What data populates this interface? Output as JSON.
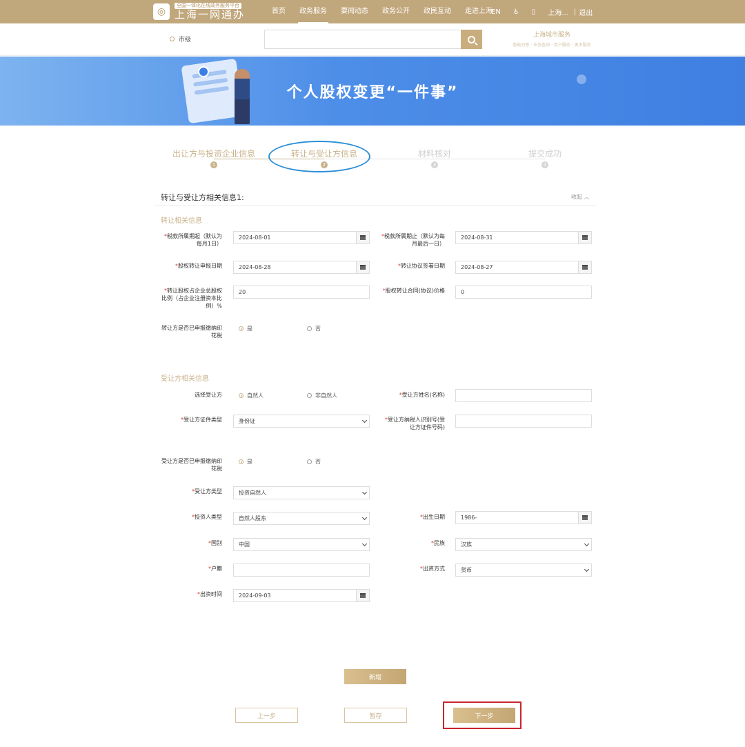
{
  "header": {
    "logo_subtitle": "全国一体化在线政务服务平台",
    "logo_title": "上海一网通办",
    "nav": [
      "首页",
      "政务服务",
      "要闻动态",
      "政务公开",
      "政民互动",
      "走进上海"
    ],
    "active_nav": 1,
    "lang": "EN",
    "user": "上海...",
    "divider": "|",
    "logout": "退出"
  },
  "search": {
    "region": "市级",
    "placeholder": "",
    "city_title": "上海城市服务",
    "city_links": "智能问答 · 业务查询 · 用户服务 · 更多服务"
  },
  "banner": {
    "title": "个人股权变更“一件事”"
  },
  "steps": [
    {
      "label": "出让方与投资企业信息",
      "num": "1"
    },
    {
      "label": "转让与受让方信息",
      "num": "2"
    },
    {
      "label": "材料核对",
      "num": "3"
    },
    {
      "label": "提交成功",
      "num": "4"
    }
  ],
  "form": {
    "section_title": "转让与受让方相关信息1:",
    "collapse": "收起",
    "transfer_subtitle": "转让相关信息",
    "tax_start_label": "税款所属期起（默认为每月1日）",
    "tax_start_value": "2024-08-01",
    "tax_end_label": "税款所属期止（默认为每月最后一日）",
    "tax_end_value": "2024-08-31",
    "declare_date_label": "股权转让申报日期",
    "declare_date_value": "2024-08-28",
    "sign_date_label": "转让协议签署日期",
    "sign_date_value": "2024-08-27",
    "ratio_label": "转让股权占企业总股权比例（占企业注册资本比例）%",
    "ratio_value": "20",
    "price_label": "股权转让合同(协议)价格",
    "price_value": "0",
    "stamp_tax_label": "转让方是否已申报缴纳印花税",
    "yes": "是",
    "no": "否",
    "receiver_subtitle": "受让方相关信息",
    "select_receiver_label": "选择受让方",
    "natural_person": "自然人",
    "non_natural_person": "非自然人",
    "receiver_name_label": "受让方姓名(名称)",
    "receiver_name_value": "",
    "cert_type_label": "受让方证件类型",
    "cert_type_value": "身份证",
    "tax_id_label": "受让方纳税人识别号(受让方证件号码)",
    "tax_id_value": "",
    "receiver_stamp_label": "受让方是否已申报缴纳印花税",
    "receiver_type_label": "受让方类型",
    "receiver_type_value": "投资自然人",
    "investor_type_label": "投资人类型",
    "investor_type_value": "自然人股东",
    "birth_label": "出生日期",
    "birth_value": "1986-",
    "country_label": "国别",
    "country_value": "中国",
    "ethnic_label": "民族",
    "ethnic_value": "汉族",
    "household_label": "户籍",
    "household_value": "",
    "contribution_label": "出资方式",
    "contribution_value": "货币",
    "contribution_time_label": "出资时间",
    "contribution_time_value": "2024-09-03",
    "required_mark": "*"
  },
  "buttons": {
    "add": "新增",
    "prev": "上一步",
    "save": "暂存",
    "next": "下一步"
  }
}
